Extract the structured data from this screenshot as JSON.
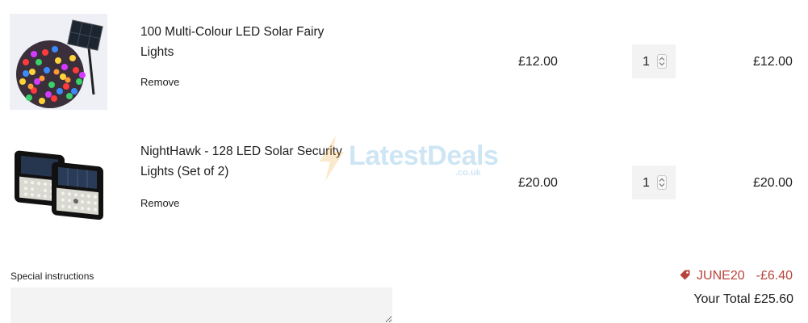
{
  "items": [
    {
      "title": "100 Multi-Colour LED Solar Fairy Lights",
      "remove_label": "Remove",
      "price": "£12.00",
      "quantity": "1",
      "line_total": "£12.00"
    },
    {
      "title": "NightHawk - 128 LED Solar Security Lights (Set of 2)",
      "remove_label": "Remove",
      "price": "£20.00",
      "quantity": "1",
      "line_total": "£20.00"
    }
  ],
  "watermark": {
    "name": "LatestDeals",
    "suffix": ".co.uk"
  },
  "special_instructions": {
    "label": "Special instructions",
    "value": ""
  },
  "discount": {
    "code": "JUNE20",
    "amount": "-£6.40",
    "color": "#b8433b"
  },
  "total": {
    "label": "Your Total",
    "value": "£25.60"
  }
}
